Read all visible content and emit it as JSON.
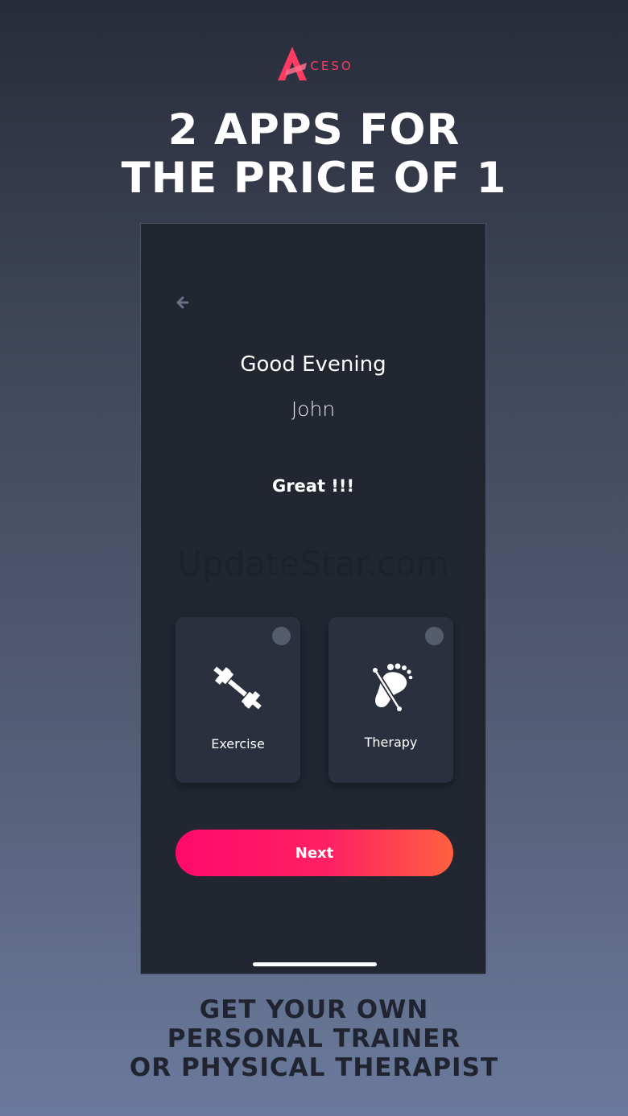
{
  "brand": {
    "logo_letter": "A",
    "logo_text": "CESO",
    "accent_color": "#ff3b63"
  },
  "headline": {
    "line1": "2 APPS FOR",
    "line2": "THE PRICE OF 1"
  },
  "screen": {
    "back_icon": "arrow-left-icon",
    "greeting": "Good Evening",
    "username": "John",
    "status": "Great !!!",
    "watermark": "UpdateStar.com",
    "options": [
      {
        "label": "Exercise",
        "icon": "dumbbell-icon",
        "selected": false
      },
      {
        "label": "Therapy",
        "icon": "foot-massage-icon",
        "selected": false
      }
    ],
    "next_label": "Next",
    "button_gradient": [
      "#ff0a6b",
      "#ff6140"
    ]
  },
  "tagline": {
    "line1": "GET YOUR OWN",
    "line2": "PERSONAL TRAINER",
    "line3": "OR PHYSICAL THERAPIST"
  }
}
